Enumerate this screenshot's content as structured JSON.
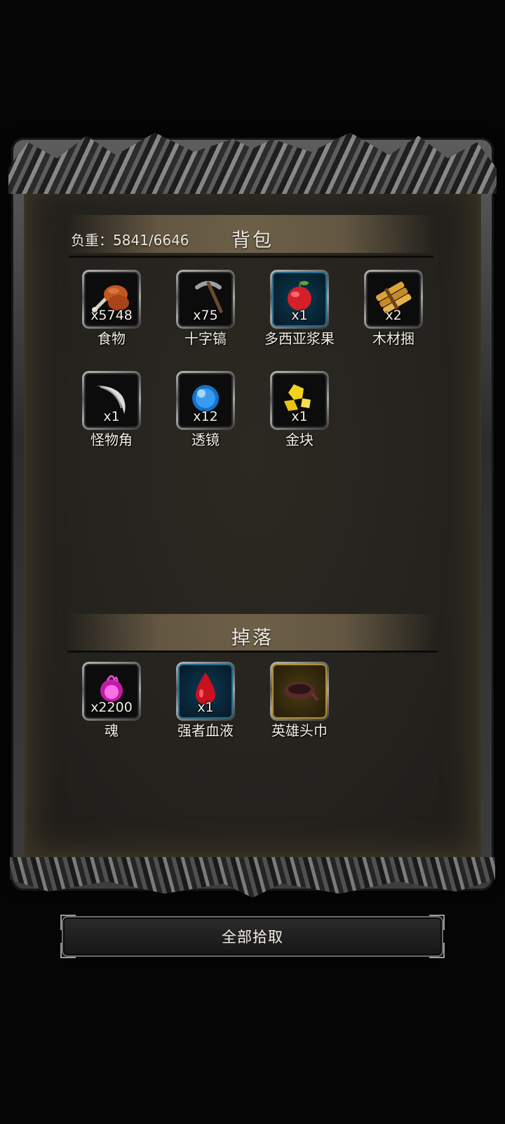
{
  "inventory": {
    "title": "背包",
    "weight_label": "负重：5841/6646",
    "items": [
      {
        "name": "食物",
        "qty": "x5748",
        "icon": "roast-meat-icon"
      },
      {
        "name": "十字镐",
        "qty": "x75",
        "icon": "pickaxe-icon"
      },
      {
        "name": "多西亚浆果",
        "qty": "x1",
        "icon": "red-berry-icon"
      },
      {
        "name": "木材捆",
        "qty": "x2",
        "icon": "wood-bundle-icon"
      },
      {
        "name": "怪物角",
        "qty": "x1",
        "icon": "monster-horn-icon"
      },
      {
        "name": "透镜",
        "qty": "x12",
        "icon": "blue-lens-icon"
      },
      {
        "name": "金块",
        "qty": "x1",
        "icon": "gold-nugget-icon"
      }
    ]
  },
  "drops": {
    "title": "掉落",
    "items": [
      {
        "name": "魂",
        "qty": "x2200",
        "icon": "soul-orb-icon"
      },
      {
        "name": "强者血液",
        "qty": "x1",
        "icon": "blood-drop-icon"
      },
      {
        "name": "英雄头巾",
        "qty": "",
        "icon": "hero-headband-icon"
      }
    ]
  },
  "actions": {
    "pick_all_label": "全部拾取"
  },
  "colors": {
    "rare_blue": "#1f6d8f",
    "epic_gold": "#b08e2c",
    "parchment": "#25231e"
  }
}
